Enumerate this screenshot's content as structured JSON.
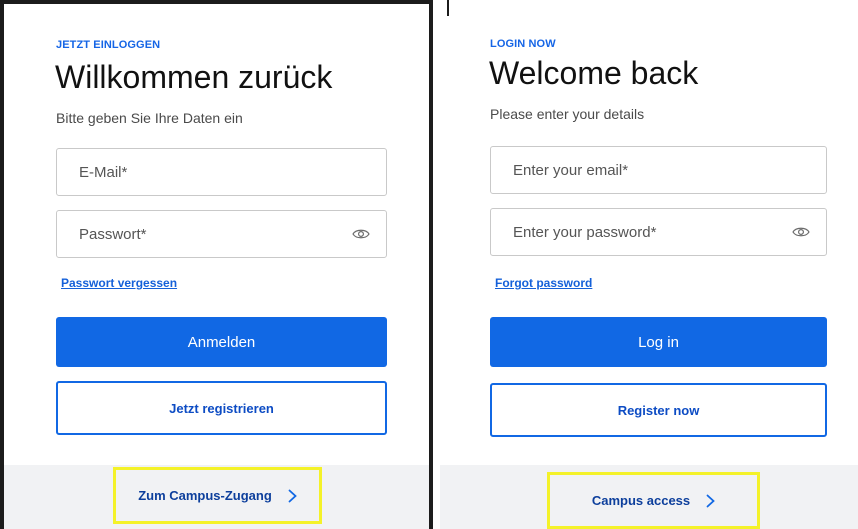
{
  "german": {
    "eyebrow": "JETZT EINLOGGEN",
    "title": "Willkommen zurück",
    "subtitle": "Bitte geben Sie Ihre Daten ein",
    "email_placeholder": "E-Mail*",
    "password_placeholder": "Passwort*",
    "forgot_link": "Passwort vergessen",
    "login_button": "Anmelden",
    "register_button": "Jetzt registrieren",
    "campus_link": "Zum Campus-Zugang"
  },
  "english": {
    "eyebrow": "LOGIN NOW",
    "title": "Welcome back",
    "subtitle": "Please enter your details",
    "email_placeholder": "Enter your email*",
    "password_placeholder": "Enter your password*",
    "forgot_link": "Forgot password",
    "login_button": "Log in",
    "register_button": "Register now",
    "campus_link": "Campus access"
  },
  "colors": {
    "accent": "#1168e4",
    "highlight": "#f4f229",
    "footer_bg": "#f1f2f4"
  },
  "icons": [
    "eye-icon",
    "chevron-right-icon"
  ]
}
